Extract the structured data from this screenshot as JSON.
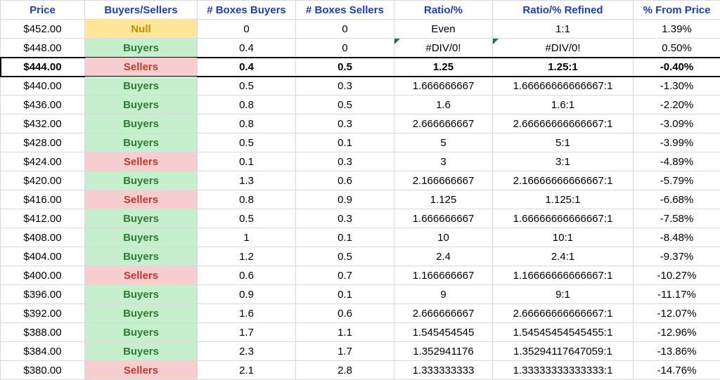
{
  "headers": {
    "price": "Price",
    "bs": "Buyers/Sellers",
    "boxes_buyers": "# Boxes Buyers",
    "boxes_sellers": "# Boxes Sellers",
    "ratio": "Ratio/%",
    "ratio_refined": "Ratio/% Refined",
    "pct_from_price": "% From Price"
  },
  "rows": [
    {
      "price": "$452.00",
      "bs": "Null",
      "bs_class": "null",
      "bb": "0",
      "sb": "0",
      "ratio": "Even",
      "rref": "1:1",
      "pct": "1.39%",
      "err": false,
      "highlight": false
    },
    {
      "price": "$448.00",
      "bs": "Buyers",
      "bs_class": "buyers",
      "bb": "0.4",
      "sb": "0",
      "ratio": "#DIV/0!",
      "rref": "#DIV/0!",
      "pct": "0.50%",
      "err": true,
      "highlight": false
    },
    {
      "price": "$444.00",
      "bs": "Sellers",
      "bs_class": "sellers",
      "bb": "0.4",
      "sb": "0.5",
      "ratio": "1.25",
      "rref": "1.25:1",
      "pct": "-0.40%",
      "err": false,
      "highlight": true
    },
    {
      "price": "$440.00",
      "bs": "Buyers",
      "bs_class": "buyers",
      "bb": "0.5",
      "sb": "0.3",
      "ratio": "1.666666667",
      "rref": "1.66666666666667:1",
      "pct": "-1.30%",
      "err": false,
      "highlight": false
    },
    {
      "price": "$436.00",
      "bs": "Buyers",
      "bs_class": "buyers",
      "bb": "0.8",
      "sb": "0.5",
      "ratio": "1.6",
      "rref": "1.6:1",
      "pct": "-2.20%",
      "err": false,
      "highlight": false
    },
    {
      "price": "$432.00",
      "bs": "Buyers",
      "bs_class": "buyers",
      "bb": "0.8",
      "sb": "0.3",
      "ratio": "2.666666667",
      "rref": "2.66666666666667:1",
      "pct": "-3.09%",
      "err": false,
      "highlight": false
    },
    {
      "price": "$428.00",
      "bs": "Buyers",
      "bs_class": "buyers",
      "bb": "0.5",
      "sb": "0.1",
      "ratio": "5",
      "rref": "5:1",
      "pct": "-3.99%",
      "err": false,
      "highlight": false
    },
    {
      "price": "$424.00",
      "bs": "Sellers",
      "bs_class": "sellers",
      "bb": "0.1",
      "sb": "0.3",
      "ratio": "3",
      "rref": "3:1",
      "pct": "-4.89%",
      "err": false,
      "highlight": false
    },
    {
      "price": "$420.00",
      "bs": "Buyers",
      "bs_class": "buyers",
      "bb": "1.3",
      "sb": "0.6",
      "ratio": "2.166666667",
      "rref": "2.16666666666667:1",
      "pct": "-5.79%",
      "err": false,
      "highlight": false
    },
    {
      "price": "$416.00",
      "bs": "Sellers",
      "bs_class": "sellers",
      "bb": "0.8",
      "sb": "0.9",
      "ratio": "1.125",
      "rref": "1.125:1",
      "pct": "-6.68%",
      "err": false,
      "highlight": false
    },
    {
      "price": "$412.00",
      "bs": "Buyers",
      "bs_class": "buyers",
      "bb": "0.5",
      "sb": "0.3",
      "ratio": "1.666666667",
      "rref": "1.66666666666667:1",
      "pct": "-7.58%",
      "err": false,
      "highlight": false
    },
    {
      "price": "$408.00",
      "bs": "Buyers",
      "bs_class": "buyers",
      "bb": "1",
      "sb": "0.1",
      "ratio": "10",
      "rref": "10:1",
      "pct": "-8.48%",
      "err": false,
      "highlight": false
    },
    {
      "price": "$404.00",
      "bs": "Buyers",
      "bs_class": "buyers",
      "bb": "1.2",
      "sb": "0.5",
      "ratio": "2.4",
      "rref": "2.4:1",
      "pct": "-9.37%",
      "err": false,
      "highlight": false
    },
    {
      "price": "$400.00",
      "bs": "Sellers",
      "bs_class": "sellers",
      "bb": "0.6",
      "sb": "0.7",
      "ratio": "1.166666667",
      "rref": "1.16666666666667:1",
      "pct": "-10.27%",
      "err": false,
      "highlight": false
    },
    {
      "price": "$396.00",
      "bs": "Buyers",
      "bs_class": "buyers",
      "bb": "0.9",
      "sb": "0.1",
      "ratio": "9",
      "rref": "9:1",
      "pct": "-11.17%",
      "err": false,
      "highlight": false
    },
    {
      "price": "$392.00",
      "bs": "Buyers",
      "bs_class": "buyers",
      "bb": "1.6",
      "sb": "0.6",
      "ratio": "2.666666667",
      "rref": "2.66666666666667:1",
      "pct": "-12.07%",
      "err": false,
      "highlight": false
    },
    {
      "price": "$388.00",
      "bs": "Buyers",
      "bs_class": "buyers",
      "bb": "1.7",
      "sb": "1.1",
      "ratio": "1.545454545",
      "rref": "1.54545454545455:1",
      "pct": "-12.96%",
      "err": false,
      "highlight": false
    },
    {
      "price": "$384.00",
      "bs": "Buyers",
      "bs_class": "buyers",
      "bb": "2.3",
      "sb": "1.7",
      "ratio": "1.352941176",
      "rref": "1.35294117647059:1",
      "pct": "-13.86%",
      "err": false,
      "highlight": false
    },
    {
      "price": "$380.00",
      "bs": "Sellers",
      "bs_class": "sellers",
      "bb": "2.1",
      "sb": "2.8",
      "ratio": "1.333333333",
      "rref": "1.33333333333333:1",
      "pct": "-14.76%",
      "err": false,
      "highlight": false
    }
  ]
}
